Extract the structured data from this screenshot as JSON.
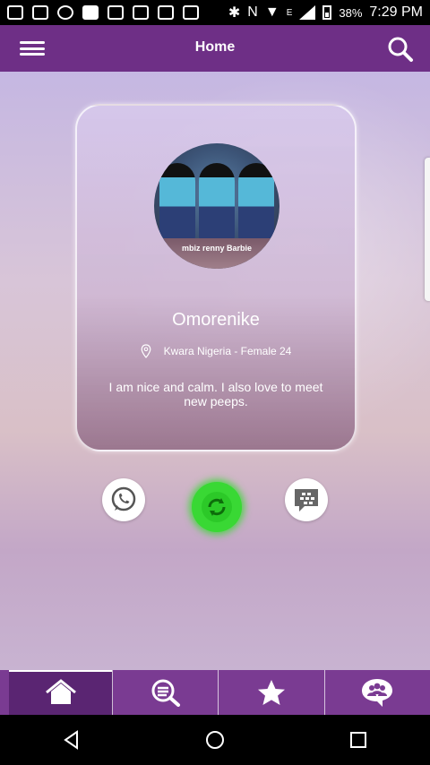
{
  "status_bar": {
    "battery_percent": "38%",
    "time": "7:29 PM",
    "network_label": "E"
  },
  "app_bar": {
    "title": "Home",
    "menu_icon": "hamburger-icon",
    "search_icon": "search-icon"
  },
  "profile": {
    "photo_watermark": "mbiz renny Barbie",
    "name": "Omorenike",
    "location_line": "Kwara Nigeria - Female 24",
    "bio": "I am nice and calm. I also love to meet new peeps."
  },
  "actions": {
    "left_icon": "whatsapp-icon",
    "center_icon": "refresh-icon",
    "right_icon": "bbm-icon",
    "center_color": "#39d834"
  },
  "bottom_nav": {
    "tabs": [
      {
        "icon": "home-icon",
        "active": true
      },
      {
        "icon": "search-list-icon",
        "active": false
      },
      {
        "icon": "star-icon",
        "active": false
      },
      {
        "icon": "chat-group-icon",
        "active": false
      }
    ]
  },
  "colors": {
    "primary": "#6e2f86",
    "nav": "#7a3b92",
    "nav_active": "#5a2572"
  }
}
